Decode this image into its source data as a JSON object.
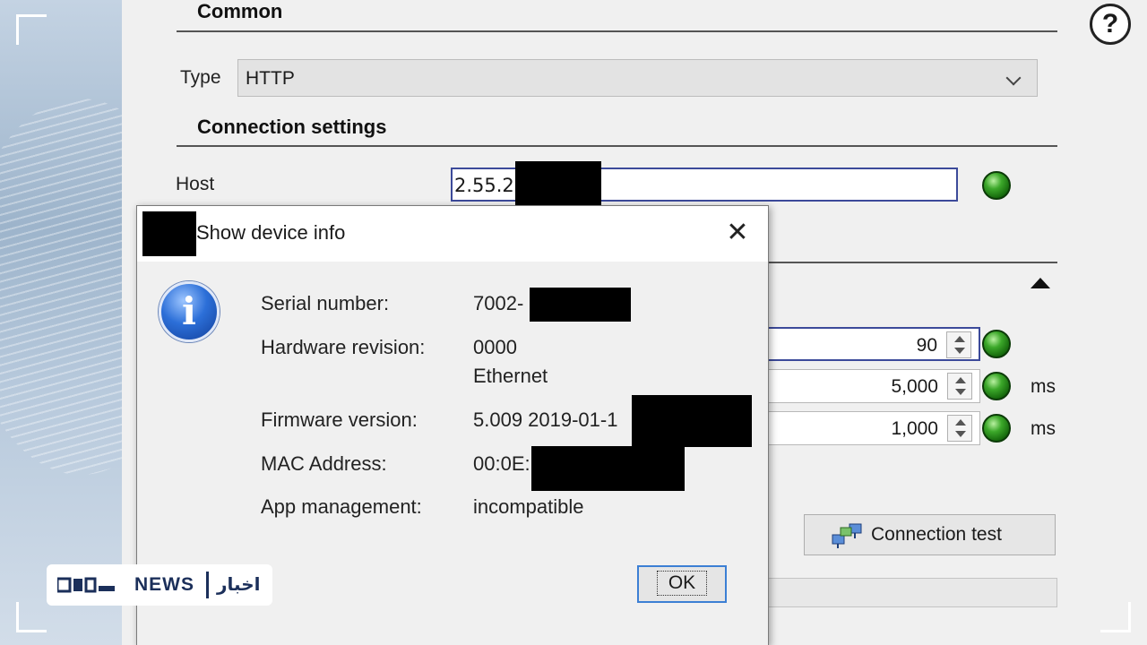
{
  "common": {
    "title": "Common",
    "type_label": "Type",
    "type_value": "HTTP"
  },
  "connection": {
    "title": "Connection settings",
    "host_label": "Host",
    "host_value": "2.55.2",
    "field1_value": "90",
    "field2_value": "5,000",
    "field2_unit": "ms",
    "field3_value": "1,000",
    "field3_unit": "ms",
    "test_button": "Connection test",
    "status_color": "#2e9a1e"
  },
  "dialog": {
    "title": "Show device info",
    "close_glyph": "✕",
    "icon_glyph": "i",
    "serial_label": "Serial number:",
    "serial_value": "7002-",
    "hw_label": "Hardware revision:",
    "hw_value": "0000",
    "hw_value2": "Ethernet",
    "fw_label": "Firmware version:",
    "fw_value": "5.009 2019-01-1",
    "mac_label": "MAC Address:",
    "mac_value": "00:0E:",
    "app_label": "App management:",
    "app_value": "incompatible",
    "ok_label": "OK"
  },
  "help_glyph": "?",
  "watermark": {
    "logo": "ФЬЛ",
    "news": "NEWS",
    "arabic": "اخبار"
  }
}
